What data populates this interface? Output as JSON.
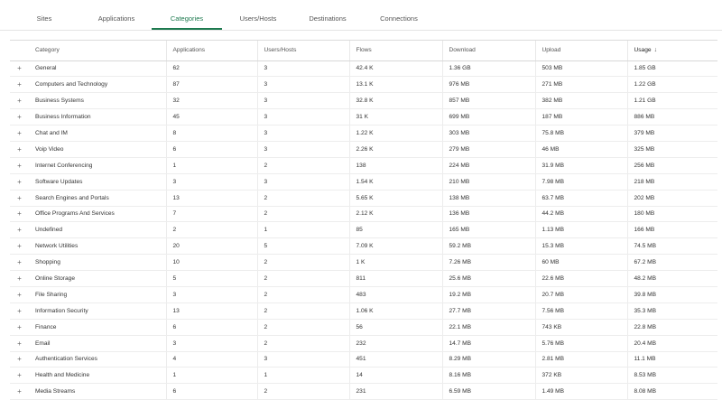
{
  "tabs": [
    {
      "label": "Sites"
    },
    {
      "label": "Applications"
    },
    {
      "label": "Categories"
    },
    {
      "label": "Users/Hosts"
    },
    {
      "label": "Destinations"
    },
    {
      "label": "Connections"
    }
  ],
  "active_tab": "Categories",
  "table": {
    "columns": [
      "Category",
      "Applications",
      "Users/Hosts",
      "Flows",
      "Download",
      "Upload",
      "Usage"
    ],
    "sort_column": "Usage",
    "sort_direction": "descending",
    "expand_symbol": "+",
    "sort_symbol": "↓",
    "rows": [
      [
        "General",
        "62",
        "3",
        "42.4 K",
        "1.36 GB",
        "503 MB",
        "1.85 GB"
      ],
      [
        "Computers and Technology",
        "87",
        "3",
        "13.1 K",
        "976 MB",
        "271 MB",
        "1.22 GB"
      ],
      [
        "Business Systems",
        "32",
        "3",
        "32.8 K",
        "857 MB",
        "382 MB",
        "1.21 GB"
      ],
      [
        "Business Information",
        "45",
        "3",
        "31 K",
        "699 MB",
        "187 MB",
        "886 MB"
      ],
      [
        "Chat and IM",
        "8",
        "3",
        "1.22 K",
        "303 MB",
        "75.8 MB",
        "379 MB"
      ],
      [
        "Voip Video",
        "6",
        "3",
        "2.26 K",
        "279 MB",
        "46 MB",
        "325 MB"
      ],
      [
        "Internet Conferencing",
        "1",
        "2",
        "138",
        "224 MB",
        "31.9 MB",
        "256 MB"
      ],
      [
        "Software Updates",
        "3",
        "3",
        "1.54 K",
        "210 MB",
        "7.98 MB",
        "218 MB"
      ],
      [
        "Search Engines and Portals",
        "13",
        "2",
        "5.65 K",
        "138 MB",
        "63.7 MB",
        "202 MB"
      ],
      [
        "Office Programs And Services",
        "7",
        "2",
        "2.12 K",
        "136 MB",
        "44.2 MB",
        "180 MB"
      ],
      [
        "Undefined",
        "2",
        "1",
        "85",
        "165 MB",
        "1.13 MB",
        "166 MB"
      ],
      [
        "Network Utilities",
        "20",
        "5",
        "7.09 K",
        "59.2 MB",
        "15.3 MB",
        "74.5 MB"
      ],
      [
        "Shopping",
        "10",
        "2",
        "1 K",
        "7.26 MB",
        "60 MB",
        "67.2 MB"
      ],
      [
        "Online Storage",
        "5",
        "2",
        "811",
        "25.6 MB",
        "22.6 MB",
        "48.2 MB"
      ],
      [
        "File Sharing",
        "3",
        "2",
        "483",
        "19.2 MB",
        "20.7 MB",
        "39.8 MB"
      ],
      [
        "Information Security",
        "13",
        "2",
        "1.06 K",
        "27.7 MB",
        "7.56 MB",
        "35.3 MB"
      ],
      [
        "Finance",
        "6",
        "2",
        "56",
        "22.1 MB",
        "743 KB",
        "22.8 MB"
      ],
      [
        "Email",
        "3",
        "2",
        "232",
        "14.7 MB",
        "5.76 MB",
        "20.4 MB"
      ],
      [
        "Authentication Services",
        "4",
        "3",
        "451",
        "8.29 MB",
        "2.81 MB",
        "11.1 MB"
      ],
      [
        "Health and Medicine",
        "1",
        "1",
        "14",
        "8.16 MB",
        "372 KB",
        "8.53 MB"
      ],
      [
        "Media Streams",
        "6",
        "2",
        "231",
        "6.59 MB",
        "1.49 MB",
        "8.08 MB"
      ]
    ]
  },
  "colors": {
    "accent": "#1e7a4f",
    "text": "#333333",
    "border": "#e4e4e4"
  }
}
